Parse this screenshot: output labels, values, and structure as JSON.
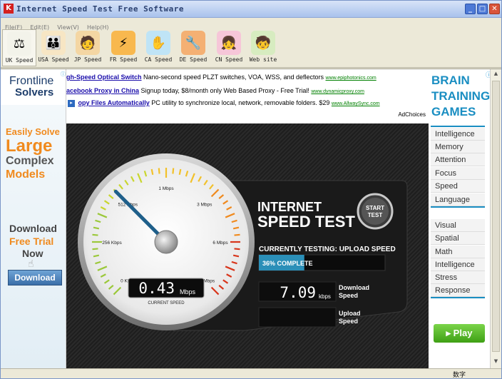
{
  "window": {
    "title": "Internet Speed Test Free Software",
    "app_icon": "K",
    "minimize_glyph": "_",
    "maximize_glyph": "□",
    "close_glyph": "✕"
  },
  "menu": [
    {
      "label": "File(F)"
    },
    {
      "label": "Edit(E)"
    },
    {
      "label": "View(V)"
    },
    {
      "label": "Help(H)"
    }
  ],
  "toolbar": {
    "items": [
      {
        "label": "UK Speed",
        "icon": "scale-icon",
        "glyph": "⚖",
        "color": "#f3f3ea"
      },
      {
        "label": "USA Speed",
        "icon": "people-icon",
        "glyph": "👪",
        "color": "#f7e6c4"
      },
      {
        "label": "JP Speed",
        "icon": "person-icon",
        "glyph": "🧑",
        "color": "#f4d6a3"
      },
      {
        "label": "FR Speed",
        "icon": "lightning-icon",
        "glyph": "⚡",
        "color": "#f8b84e"
      },
      {
        "label": "CA Speed",
        "icon": "hand-icon",
        "glyph": "✋",
        "color": "#bfe4f6"
      },
      {
        "label": "DE Speed",
        "icon": "tools-icon",
        "glyph": "🔧",
        "color": "#f4b073"
      },
      {
        "label": "CN Speed",
        "icon": "girl-icon",
        "glyph": "👧",
        "color": "#f6c6d8"
      },
      {
        "label": "Web site",
        "icon": "child-icon",
        "glyph": "🧒",
        "color": "#d7ecc0"
      }
    ]
  },
  "left_ad": {
    "brand_line1": "Frontline",
    "brand_line2": "Solvers",
    "info_glyph": "ⓘ",
    "easily": "Easily Solve",
    "large": "Large",
    "complex": "Complex",
    "models": "Models",
    "download_word": "Download",
    "free_trial": "Free Trial",
    "now": "Now",
    "button": "Download",
    "cursor_glyph": "☝"
  },
  "ads": [
    {
      "link": "gh-Speed Optical Switch",
      "text": "Nano-second speed PLZT switches, VOA, WSS, and deflectors",
      "url": "www.epiphotonics.com"
    },
    {
      "link": "acebook Proxy in China",
      "text": "Signup today, $8/month only Web Based Proxy - Free Trial!",
      "url": "www.dynamicproxy.com"
    },
    {
      "link": "opy Files Automatically",
      "text": "PC utility to synchronize local, network, removable folders. $29",
      "url": "www.AllwaySync.com"
    }
  ],
  "ad_arrow": "▸",
  "adchoices": "AdChoices",
  "speedtest": {
    "title_line1": "INTERNET",
    "title_line2": "SPEED TEST",
    "start_line1": "START",
    "start_line2": "TEST",
    "testing_label": "CURRENTLY TESTING: UPLOAD SPEED",
    "progress_text": "36% COMPLETE",
    "progress": 0.36,
    "current_value": "0.43",
    "current_unit": "Mbps",
    "current_label": "CURRENT SPEED",
    "download_value": "7.09",
    "download_unit": "kbps",
    "download_label1": "Download",
    "download_label2": "Speed",
    "upload_value": "",
    "upload_label1": "Upload",
    "upload_label2": "Speed",
    "gauge_labels": [
      "0 Kbps",
      "256 Kbps",
      "512 Kbps",
      "1 Mbps",
      "3 Mbps",
      "6 Mbps",
      "10+ Mbps"
    ],
    "needle_value": "512 Kbps"
  },
  "right_ad": {
    "title": [
      "BRAIN",
      "TRAINING",
      "GAMES"
    ],
    "info_glyph": "ⓘ",
    "group1": [
      "Intelligence",
      "Memory",
      "Attention",
      "Focus",
      "Speed",
      "Language"
    ],
    "group2": [
      "Visual",
      "Spatial",
      "Math",
      "Intelligence",
      "Stress",
      "Response"
    ],
    "play": "▸ Play"
  },
  "scrollbar": {
    "up": "▲",
    "down": "▼"
  },
  "status": {
    "text": "数字"
  }
}
